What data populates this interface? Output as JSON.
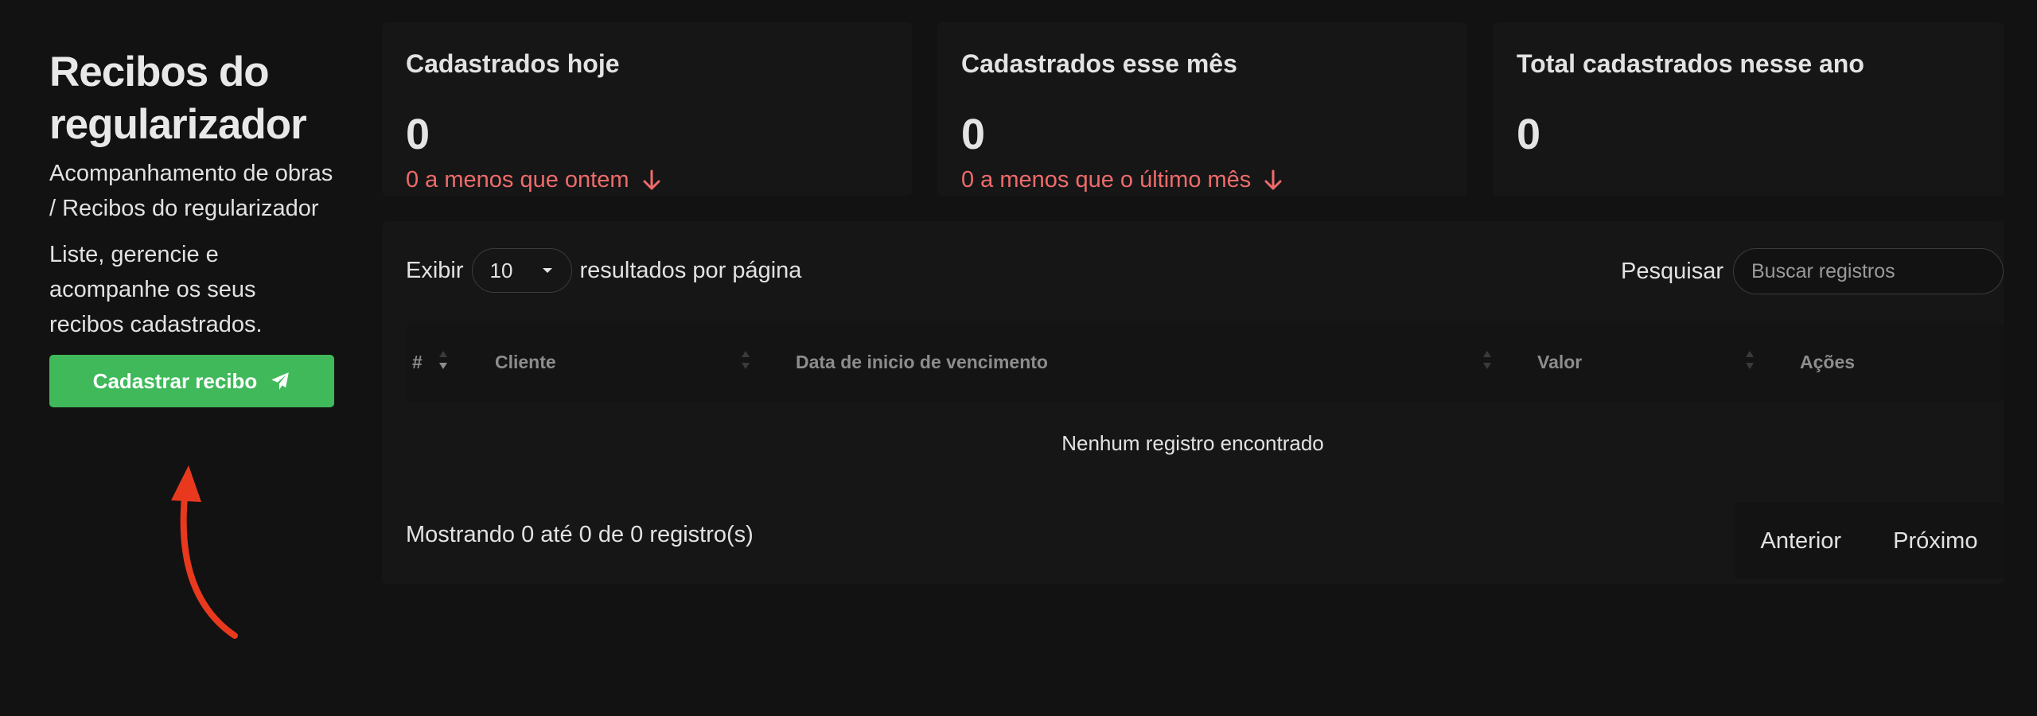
{
  "header": {
    "title": "Recibos do regularizador",
    "breadcrumb": "Acompanhamento de obras / Recibos do regularizador",
    "description": "Liste, gerencie e acompanhe os seus recibos cadastrados.",
    "cta_label": "Cadastrar recibo",
    "cta_icon": "paper-plane-icon"
  },
  "stats": [
    {
      "title": "Cadastrados hoje",
      "value": "0",
      "delta": "0 a menos que ontem",
      "delta_icon": "arrow-down-icon"
    },
    {
      "title": "Cadastrados esse mês",
      "value": "0",
      "delta": "0 a menos que o último mês",
      "delta_icon": "arrow-down-icon"
    },
    {
      "title": "Total cadastrados nesse ano",
      "value": "0"
    }
  ],
  "table": {
    "length_prefix": "Exibir",
    "length_value": "10",
    "length_suffix": "resultados por página",
    "search_label": "Pesquisar",
    "search_placeholder": "Buscar registros",
    "columns": [
      "#",
      "Cliente",
      "Data de inicio de vencimento",
      "Valor",
      "Ações"
    ],
    "empty_text": "Nenhum registro encontrado",
    "info": "Mostrando 0 até 0 de 0 registro(s)",
    "prev_label": "Anterior",
    "next_label": "Próximo"
  },
  "colors": {
    "background": "#121212",
    "card": "#161616",
    "accent_green": "#3fb95a",
    "negative_red": "#ef6b6b",
    "annotation_arrow": "#e8391f"
  }
}
